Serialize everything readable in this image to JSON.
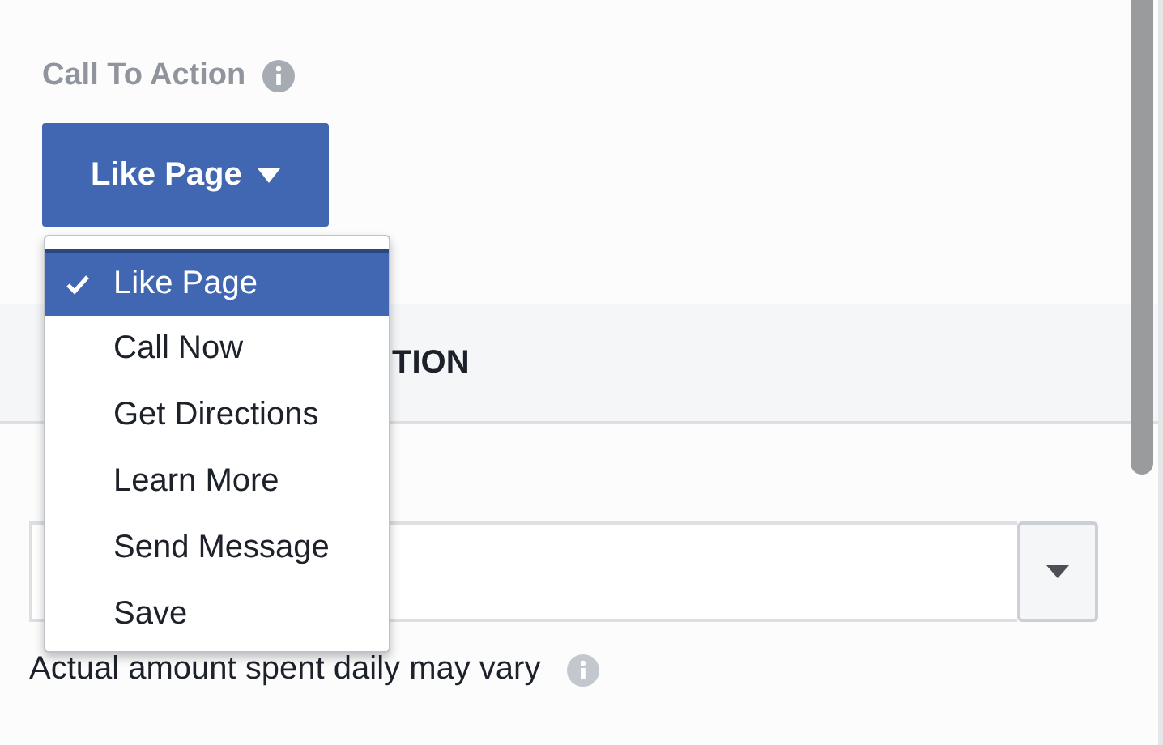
{
  "call_to_action": {
    "label": "Call To Action",
    "button": {
      "label": "Like Page",
      "expanded": true
    }
  },
  "menu": [
    {
      "label": "Like Page",
      "selected": true
    },
    {
      "label": "Call Now",
      "selected": false
    },
    {
      "label": "Get Directions",
      "selected": false
    },
    {
      "label": "Learn More",
      "selected": false
    },
    {
      "label": "Send Message",
      "selected": false
    },
    {
      "label": "Save",
      "selected": false
    }
  ],
  "section": {
    "title_right": "TION"
  },
  "budget": {
    "note": "Actual amount spent daily may vary"
  }
}
